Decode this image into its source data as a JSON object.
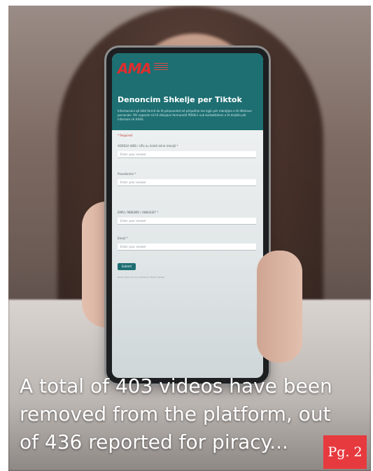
{
  "form": {
    "logo": "AMA",
    "title": "Denoncim Shkelje per Tiktok",
    "description": "Informacioni që këtë formë do të përpunohet në përputhje me ligjin për mbrojtjen e të dhënave personale. Për supozim në të shkojave formularët PDSN e nuk kontaktoheni e të drejtën për informim në AAAS.",
    "required_note": "* Required",
    "questions": [
      {
        "label": "ADRESA WEB / URL ku është kënë shkeljë *",
        "placeholder": "Enter your answer"
      },
      {
        "label": "Pseudonimi *",
        "placeholder": "Enter your answer"
      },
      {
        "label": "EMRI / MBIEMRI / ANKUESIT *",
        "placeholder": "Enter your answer"
      },
      {
        "label": "Email *",
        "placeholder": "Enter your answer"
      }
    ],
    "submit_label": "Submit",
    "footer_note": "Never give out your password. Report abuse"
  },
  "caption": "A total of 403 videos have been removed from the platform, out of 436 reported for piracy...",
  "page_badge": "Pg. 2",
  "colors": {
    "form_header": "#1d6f72",
    "logo": "#e02d2d",
    "badge": "#e73a3f"
  }
}
